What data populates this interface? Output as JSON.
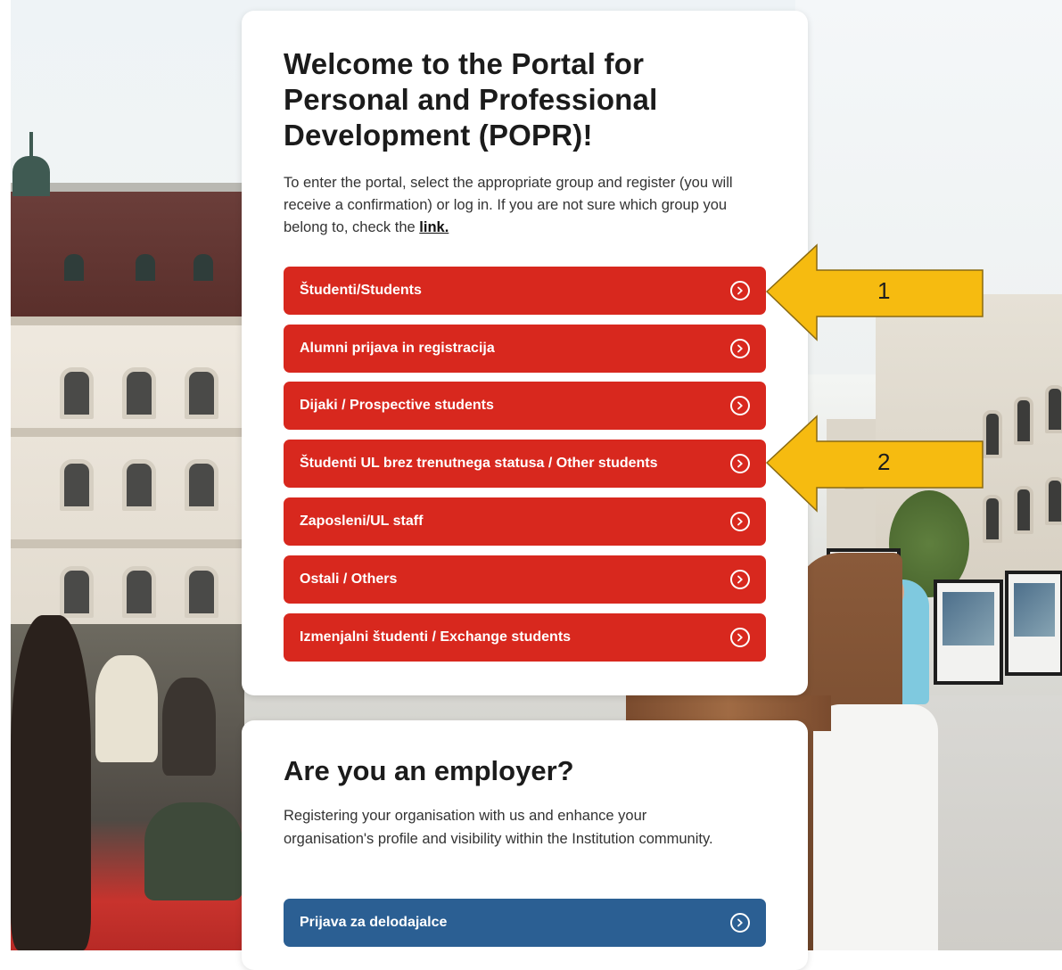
{
  "portal": {
    "title": "Welcome to the Portal for Personal and Professional Development (POPR)!",
    "intro_text": "To enter the portal, select the appropriate group and register (you will receive a confirmation) or log in. If you are not sure which group you belong to, check the ",
    "intro_link": "link.",
    "groups": [
      {
        "label": "Študenti/Students",
        "icon": "chevron-circle-right-icon"
      },
      {
        "label": "Alumni prijava in registracija",
        "icon": "chevron-circle-right-icon"
      },
      {
        "label": "Dijaki / Prospective students",
        "icon": "chevron-circle-right-icon"
      },
      {
        "label": "Študenti UL brez trenutnega statusa / Other students",
        "icon": "chevron-circle-right-icon"
      },
      {
        "label": "Zaposleni/UL staff",
        "icon": "chevron-circle-right-icon"
      },
      {
        "label": "Ostali / Others",
        "icon": "chevron-circle-right-icon"
      },
      {
        "label": "Izmenjalni študenti / Exchange students",
        "icon": "chevron-circle-right-icon"
      }
    ]
  },
  "employer": {
    "title": "Are you an employer?",
    "text": "Registering your organisation with us and enhance your organisation's profile and visibility within the Institution community.",
    "button_label": "Prijava za delodajalce"
  },
  "annotations": [
    {
      "number": "1"
    },
    {
      "number": "2"
    }
  ],
  "colors": {
    "primary_red": "#d8281e",
    "employer_blue": "#2b5f93",
    "annotation_yellow": "#f6bb10"
  }
}
